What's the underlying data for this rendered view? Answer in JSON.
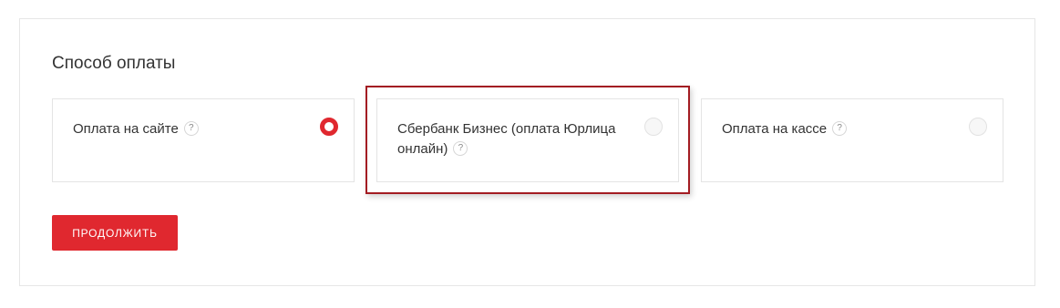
{
  "section": {
    "title": "Способ оплаты"
  },
  "options": [
    {
      "label": "Оплата на сайте",
      "help": "?",
      "selected": true
    },
    {
      "label": "Сбербанк Бизнес (оплата Юрлица онлайн)",
      "help": "?",
      "selected": false
    },
    {
      "label": "Оплата на кассе",
      "help": "?",
      "selected": false
    }
  ],
  "continue_button": {
    "label": "ПРОДОЛЖИТЬ"
  },
  "colors": {
    "accent": "#e0282f",
    "highlight_border": "#a31c22",
    "text": "#333333"
  }
}
